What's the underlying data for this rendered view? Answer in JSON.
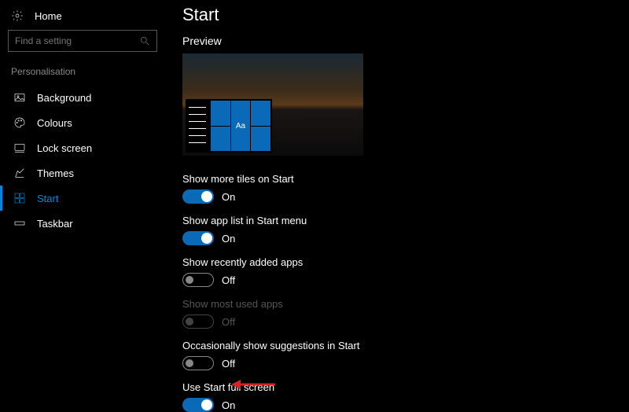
{
  "sidebar": {
    "home_label": "Home",
    "search_placeholder": "Find a setting",
    "section_header": "Personalisation",
    "items": [
      {
        "label": "Background"
      },
      {
        "label": "Colours"
      },
      {
        "label": "Lock screen"
      },
      {
        "label": "Themes"
      },
      {
        "label": "Start"
      },
      {
        "label": "Taskbar"
      }
    ]
  },
  "main": {
    "title": "Start",
    "preview_label": "Preview",
    "preview_tile_text": "Aa",
    "settings": [
      {
        "label": "Show more tiles on Start",
        "state": "On"
      },
      {
        "label": "Show app list in Start menu",
        "state": "On"
      },
      {
        "label": "Show recently added apps",
        "state": "Off"
      },
      {
        "label": "Show most used apps",
        "state": "Off"
      },
      {
        "label": "Occasionally show suggestions in Start",
        "state": "Off"
      },
      {
        "label": "Use Start full screen",
        "state": "On"
      }
    ]
  },
  "colors": {
    "accent": "#0a6ab8"
  }
}
